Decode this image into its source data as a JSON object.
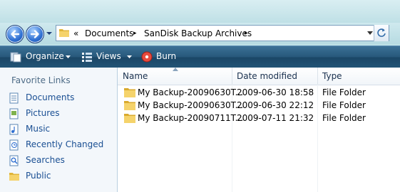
{
  "address_bar": {
    "prefix": "«",
    "crumbs": [
      "Documents",
      "SanDisk Backup Archives"
    ],
    "separator": "▸"
  },
  "toolbar": {
    "organize_label": "Organize",
    "views_label": "Views",
    "burn_label": "Burn"
  },
  "nav_pane": {
    "header": "Favorite Links",
    "items": [
      {
        "label": "Documents",
        "icon": "documents-icon"
      },
      {
        "label": "Pictures",
        "icon": "pictures-icon"
      },
      {
        "label": "Music",
        "icon": "music-icon"
      },
      {
        "label": "Recently Changed",
        "icon": "recently-changed-icon"
      },
      {
        "label": "Searches",
        "icon": "searches-icon"
      },
      {
        "label": "Public",
        "icon": "public-folder-icon"
      }
    ]
  },
  "file_list": {
    "columns": [
      "Name",
      "Date modified",
      "Type"
    ],
    "sorted_column": "Name",
    "rows": [
      {
        "name": "My Backup-20090630T...",
        "date": "2009-06-30 18:58",
        "type": "File Folder"
      },
      {
        "name": "My Backup-20090630T...",
        "date": "2009-06-30 22:12",
        "type": "File Folder"
      },
      {
        "name": "My Backup-20090711T...",
        "date": "2009-07-11 21:32",
        "type": "File Folder"
      }
    ]
  },
  "colors": {
    "toolbar": "#1b4666",
    "link": "#1a4f93",
    "folder": "#f2c94c"
  }
}
